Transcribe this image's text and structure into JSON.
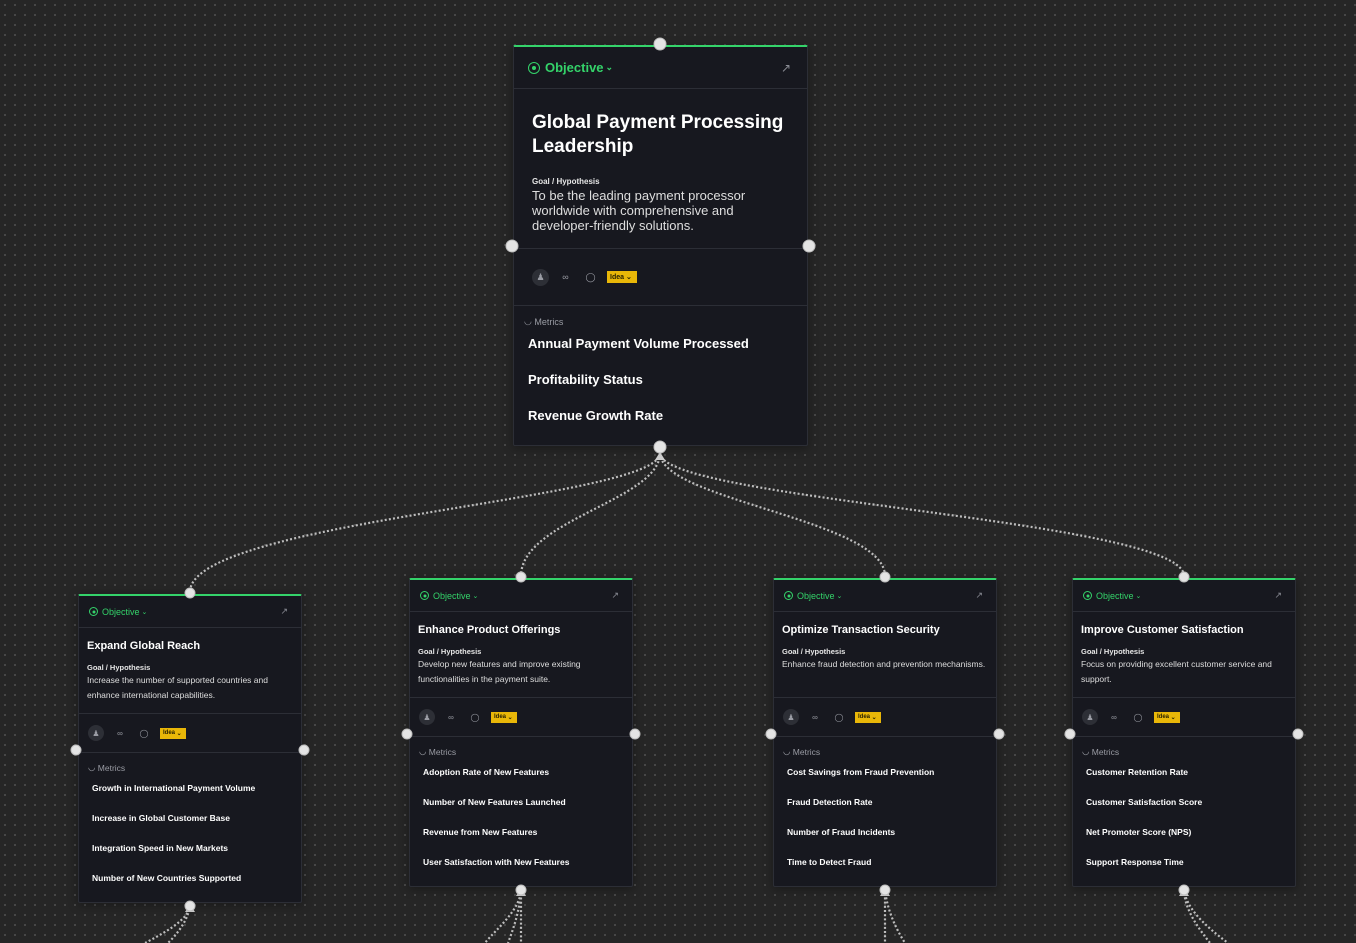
{
  "colors": {
    "accent": "#34d36a",
    "card_bg": "#17181f",
    "canvas_bg": "#262626",
    "status_badge": "#e9b708"
  },
  "root": {
    "type_label": "Objective",
    "title": "Global Payment Processing Leadership",
    "goal_label": "Goal / Hypothesis",
    "goal_text": "To be the leading payment processor worldwide with comprehensive and developer-friendly solutions.",
    "status": "Idea",
    "metrics_label": "Metrics",
    "metrics": [
      "Annual Payment Volume Processed",
      "Profitability Status",
      "Revenue Growth Rate"
    ]
  },
  "children": [
    {
      "type_label": "Objective",
      "title": "Expand Global Reach",
      "goal_label": "Goal / Hypothesis",
      "goal_text": "Increase the number of supported countries and enhance international capabilities.",
      "status": "Idea",
      "metrics_label": "Metrics",
      "metrics": [
        "Growth in International Payment Volume",
        "Increase in Global Customer Base",
        "Integration Speed in New Markets",
        "Number of New Countries Supported"
      ]
    },
    {
      "type_label": "Objective",
      "title": "Enhance Product Offerings",
      "goal_label": "Goal / Hypothesis",
      "goal_text": "Develop new features and improve existing functionalities in the payment suite.",
      "status": "Idea",
      "metrics_label": "Metrics",
      "metrics": [
        "Adoption Rate of New Features",
        "Number of New Features Launched",
        "Revenue from New Features",
        "User Satisfaction with New Features"
      ]
    },
    {
      "type_label": "Objective",
      "title": "Optimize Transaction Security",
      "goal_label": "Goal / Hypothesis",
      "goal_text": "Enhance fraud detection and prevention mechanisms.",
      "status": "Idea",
      "metrics_label": "Metrics",
      "metrics": [
        "Cost Savings from Fraud Prevention",
        "Fraud Detection Rate",
        "Number of Fraud Incidents",
        "Time to Detect Fraud"
      ]
    },
    {
      "type_label": "Objective",
      "title": "Improve Customer Satisfaction",
      "goal_label": "Goal / Hypothesis",
      "goal_text": "Focus on providing excellent customer service and support.",
      "status": "Idea",
      "metrics_label": "Metrics",
      "metrics": [
        "Customer Retention Rate",
        "Customer Satisfaction Score",
        "Net Promoter Score (NPS)",
        "Support Response Time"
      ]
    }
  ],
  "icons": {
    "type": "target-icon",
    "open": "open-arrow-icon",
    "assignee": "user-icon",
    "link": "link-icon",
    "comment": "comment-icon",
    "metrics": "gauge-icon",
    "chevron": "chevron-down-icon"
  }
}
